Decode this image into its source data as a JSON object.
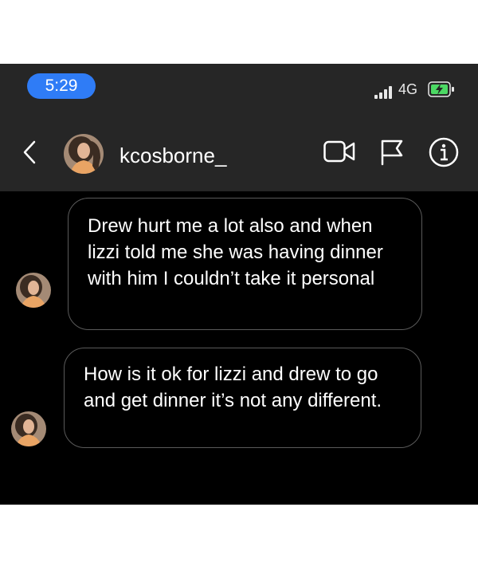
{
  "status_bar": {
    "time": "5:29",
    "network": "4G",
    "signal_icon": "signal-bars-icon",
    "battery_icon": "battery-charging-icon",
    "time_pill_color": "#2f7cf6"
  },
  "header": {
    "username": "kcosborne_",
    "back_icon": "chevron-left-icon",
    "video_icon": "video-camera-icon",
    "flag_icon": "flag-icon",
    "info_icon": "info-icon",
    "background": "#262626"
  },
  "messages": [
    {
      "sender": "kcosborne_",
      "text": "Drew hurt me a lot also and when lizzi told me she was having dinner with him I couldn’t take it personal"
    },
    {
      "sender": "kcosborne_",
      "text": "How is it ok for lizzi and drew to go and get dinner it’s not any different."
    }
  ],
  "theme": {
    "chat_background": "#000000",
    "bubble_border": "#5a5a5a",
    "text_color": "#ffffff"
  }
}
